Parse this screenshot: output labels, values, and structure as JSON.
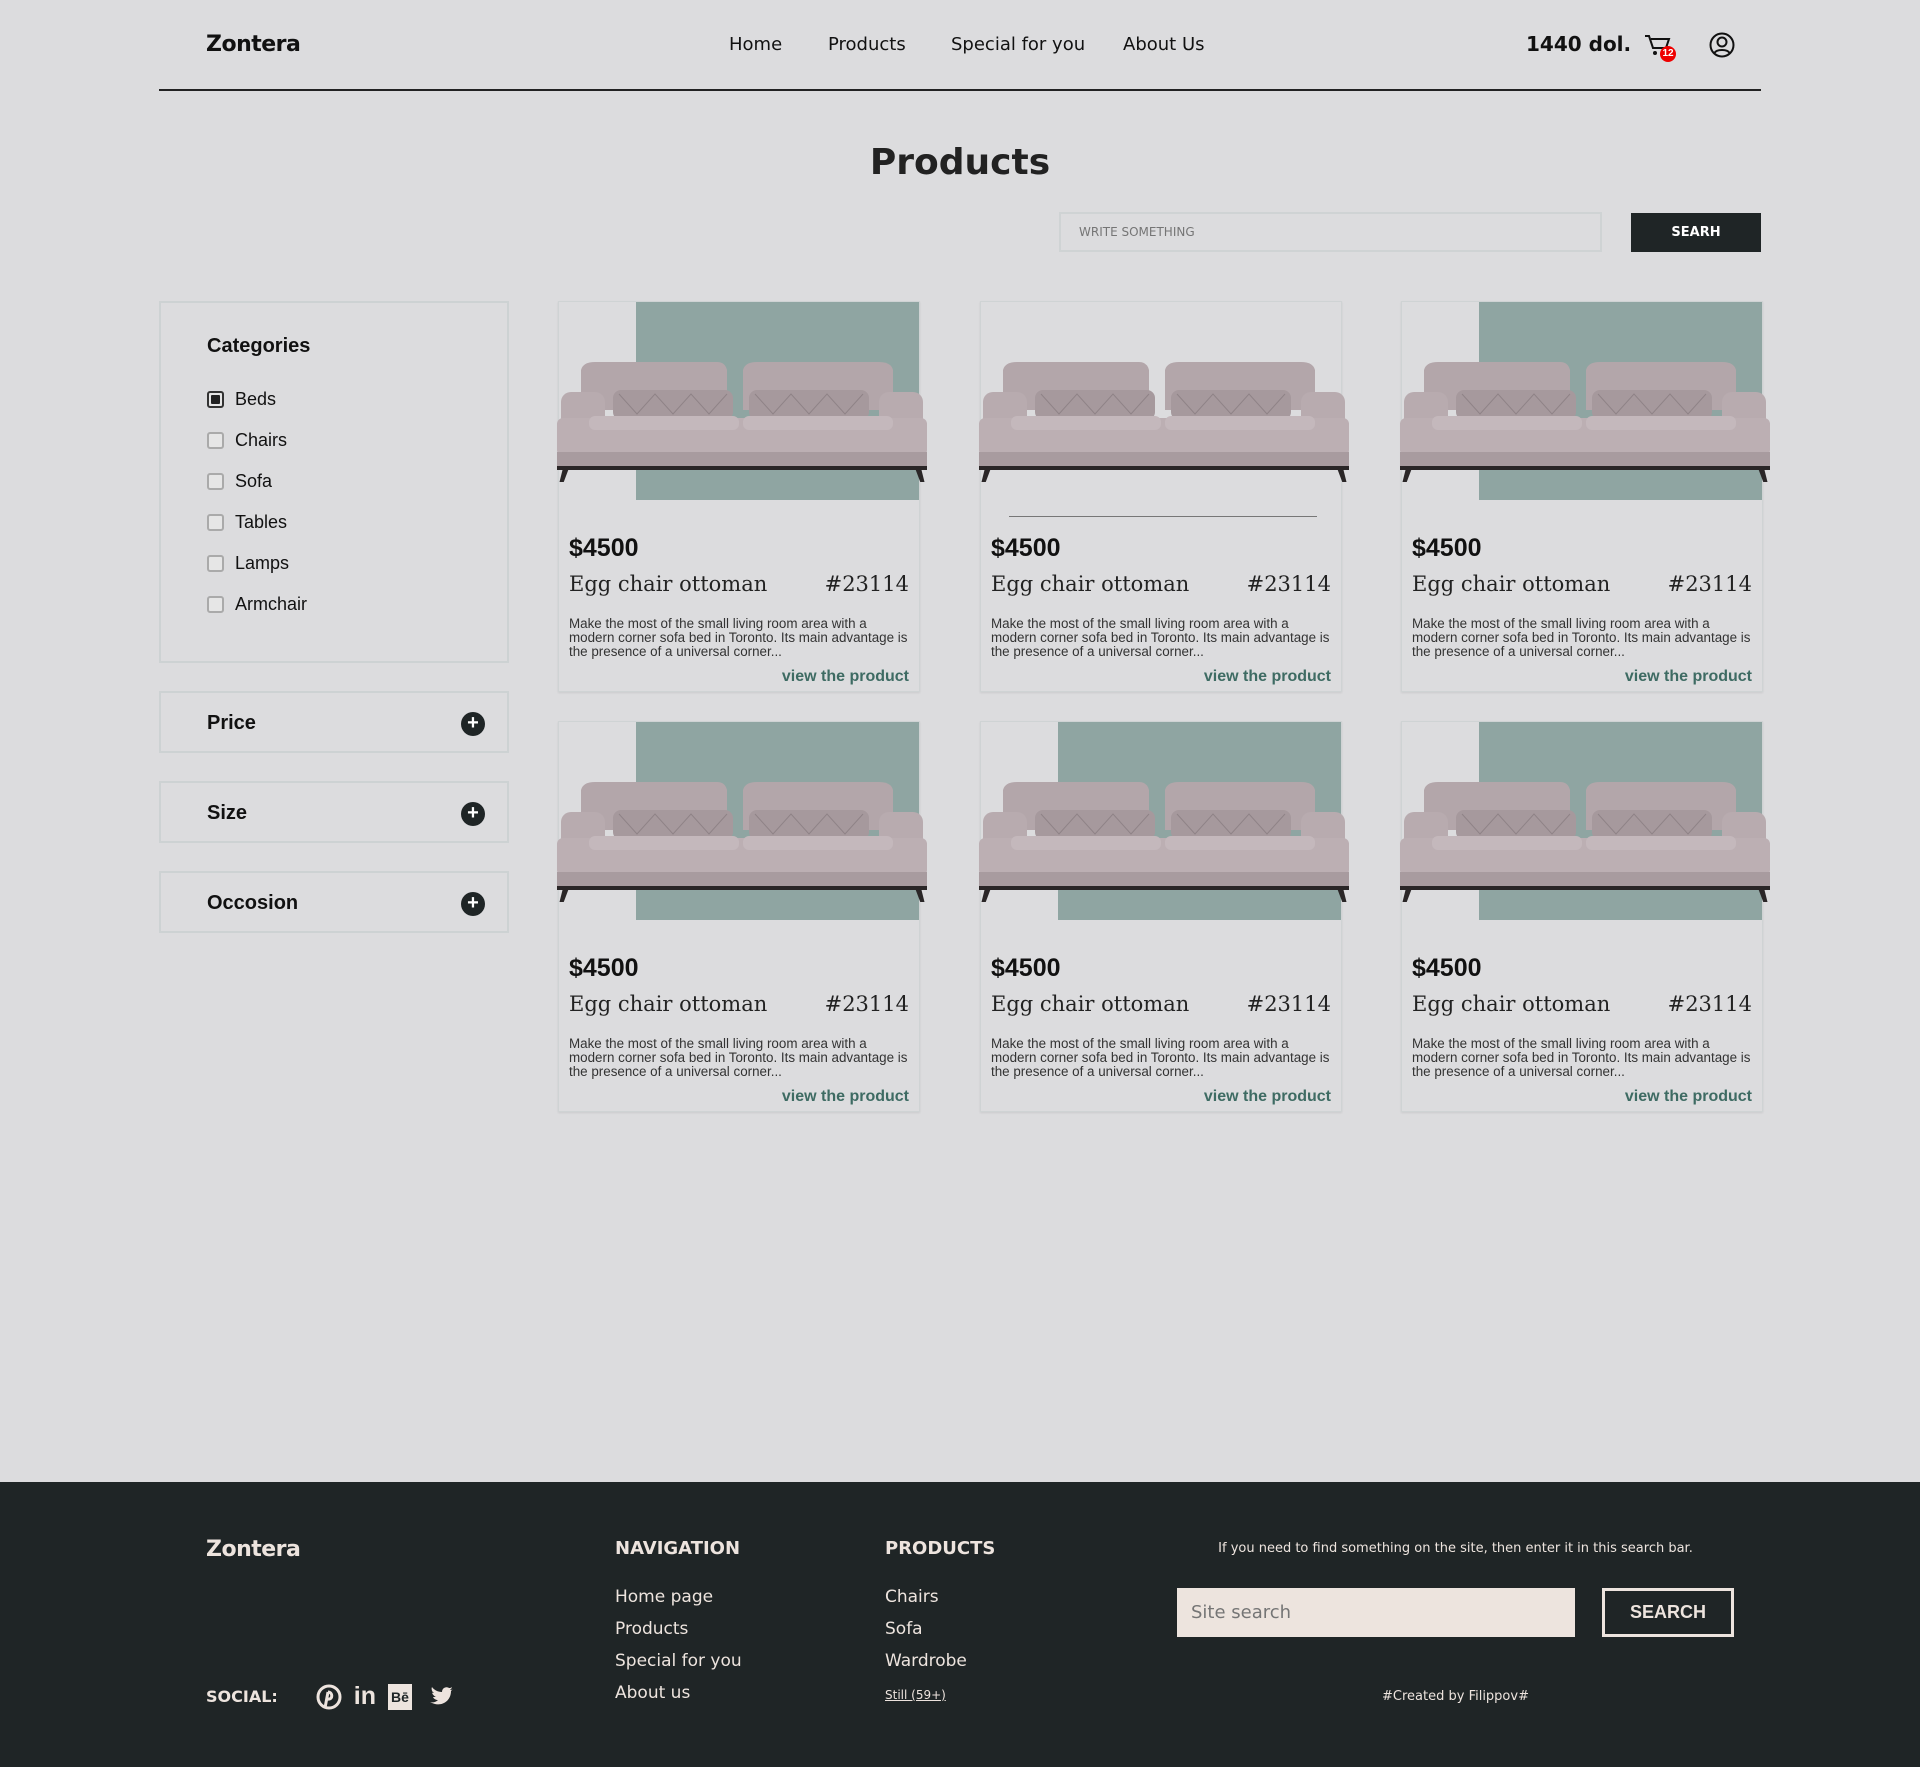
{
  "header": {
    "logo": "Zontera",
    "nav": [
      "Home",
      "Products",
      "Special for you",
      "About Us"
    ],
    "balance": "1440 dol.",
    "cart_count": "12"
  },
  "page_title": "Products",
  "search": {
    "placeholder": "WRITE SOMETHING",
    "button": "SEARH"
  },
  "sidebar": {
    "categories_title": "Categories",
    "categories": [
      {
        "label": "Beds",
        "checked": true
      },
      {
        "label": "Chairs",
        "checked": false
      },
      {
        "label": "Sofa",
        "checked": false
      },
      {
        "label": "Tables",
        "checked": false
      },
      {
        "label": "Lamps",
        "checked": false
      },
      {
        "label": "Armchair",
        "checked": false
      }
    ],
    "filters": [
      "Price",
      "Size",
      "Occosion"
    ]
  },
  "products": [
    {
      "price": "$4500",
      "name": "Egg chair ottoman",
      "id": "#23114",
      "desc": "Make the most of the small living room area with a modern corner sofa bed in Toronto. Its main advantage is the presence of a universal corner...",
      "link": "view the product"
    },
    {
      "price": "$4500",
      "name": "Egg chair ottoman",
      "id": "#23114",
      "desc": "Make the most of the small living room area with a modern corner sofa bed in Toronto. Its main advantage is the presence of a universal corner...",
      "link": "view the product"
    },
    {
      "price": "$4500",
      "name": "Egg chair ottoman",
      "id": "#23114",
      "desc": "Make the most of the small living room area with a modern corner sofa bed in Toronto. Its main advantage is the presence of a universal corner...",
      "link": "view the product"
    },
    {
      "price": "$4500",
      "name": "Egg chair ottoman",
      "id": "#23114",
      "desc": "Make the most of the small living room area with a modern corner sofa bed in Toronto. Its main advantage is the presence of a universal corner...",
      "link": "view the product"
    },
    {
      "price": "$4500",
      "name": "Egg chair ottoman",
      "id": "#23114",
      "desc": "Make the most of the small living room area with a modern corner sofa bed in Toronto. Its main advantage is the presence of a universal corner...",
      "link": "view the product"
    },
    {
      "price": "$4500",
      "name": "Egg chair ottoman",
      "id": "#23114",
      "desc": "Make the most of the small living room area with a modern corner sofa bed in Toronto. Its main advantage is the presence of a universal corner...",
      "link": "view the product"
    }
  ],
  "footer": {
    "logo": "Zontera",
    "nav_title": "NAVIGATION",
    "nav": [
      "Home page",
      "Products",
      "Special for you",
      "About us"
    ],
    "products_title": "PRODUCTS",
    "products": [
      "Chairs",
      "Sofa",
      "Wardrobe"
    ],
    "products_more": "Still (59+)",
    "social_label": "SOCIAL:",
    "search_note": "If you need to find something on the site, then enter it in this search bar.",
    "search_placeholder": "Site search",
    "search_button": "SEARCH",
    "credit": "#Created by Filippov#"
  },
  "colors": {
    "accent": "#8fa5a2",
    "dark": "#1f2526",
    "link": "#3e6b63",
    "badge": "#e00000"
  }
}
